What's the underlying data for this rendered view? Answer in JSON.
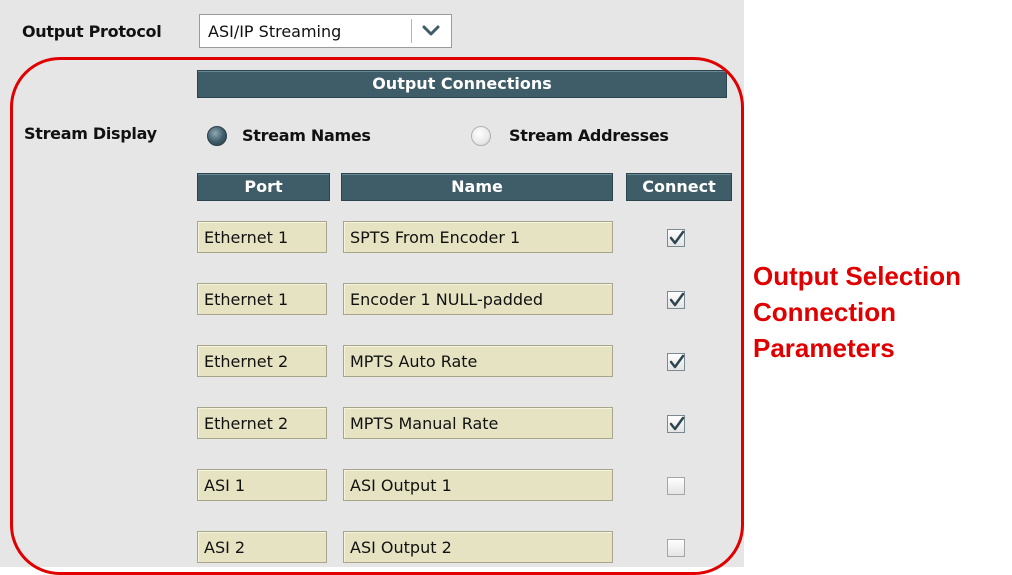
{
  "output_protocol": {
    "label": "Output Protocol",
    "selected": "ASI/IP Streaming"
  },
  "output_connections_header": "Output Connections",
  "stream_display": {
    "label": "Stream Display",
    "options": [
      {
        "label": "Stream Names",
        "selected": true
      },
      {
        "label": "Stream Addresses",
        "selected": false
      }
    ]
  },
  "columns": {
    "port": "Port",
    "name": "Name",
    "connect": "Connect"
  },
  "rows": [
    {
      "port": "Ethernet 1",
      "name": "SPTS From Encoder 1",
      "connected": true
    },
    {
      "port": "Ethernet 1",
      "name": "Encoder 1 NULL-padded",
      "connected": true
    },
    {
      "port": "Ethernet 2",
      "name": "MPTS Auto Rate",
      "connected": true
    },
    {
      "port": "Ethernet 2",
      "name": "MPTS Manual Rate",
      "connected": true
    },
    {
      "port": "ASI 1",
      "name": "ASI Output 1",
      "connected": false
    },
    {
      "port": "ASI 2",
      "name": "ASI Output 2",
      "connected": false
    }
  ],
  "annotation": {
    "lines": [
      "Output Selection",
      "Connection",
      "Parameters"
    ],
    "color": "#e10000"
  },
  "colors": {
    "header_bg": "#3e5d69",
    "field_bg": "#e6e3c3",
    "panel_bg": "#e6e6e6"
  }
}
